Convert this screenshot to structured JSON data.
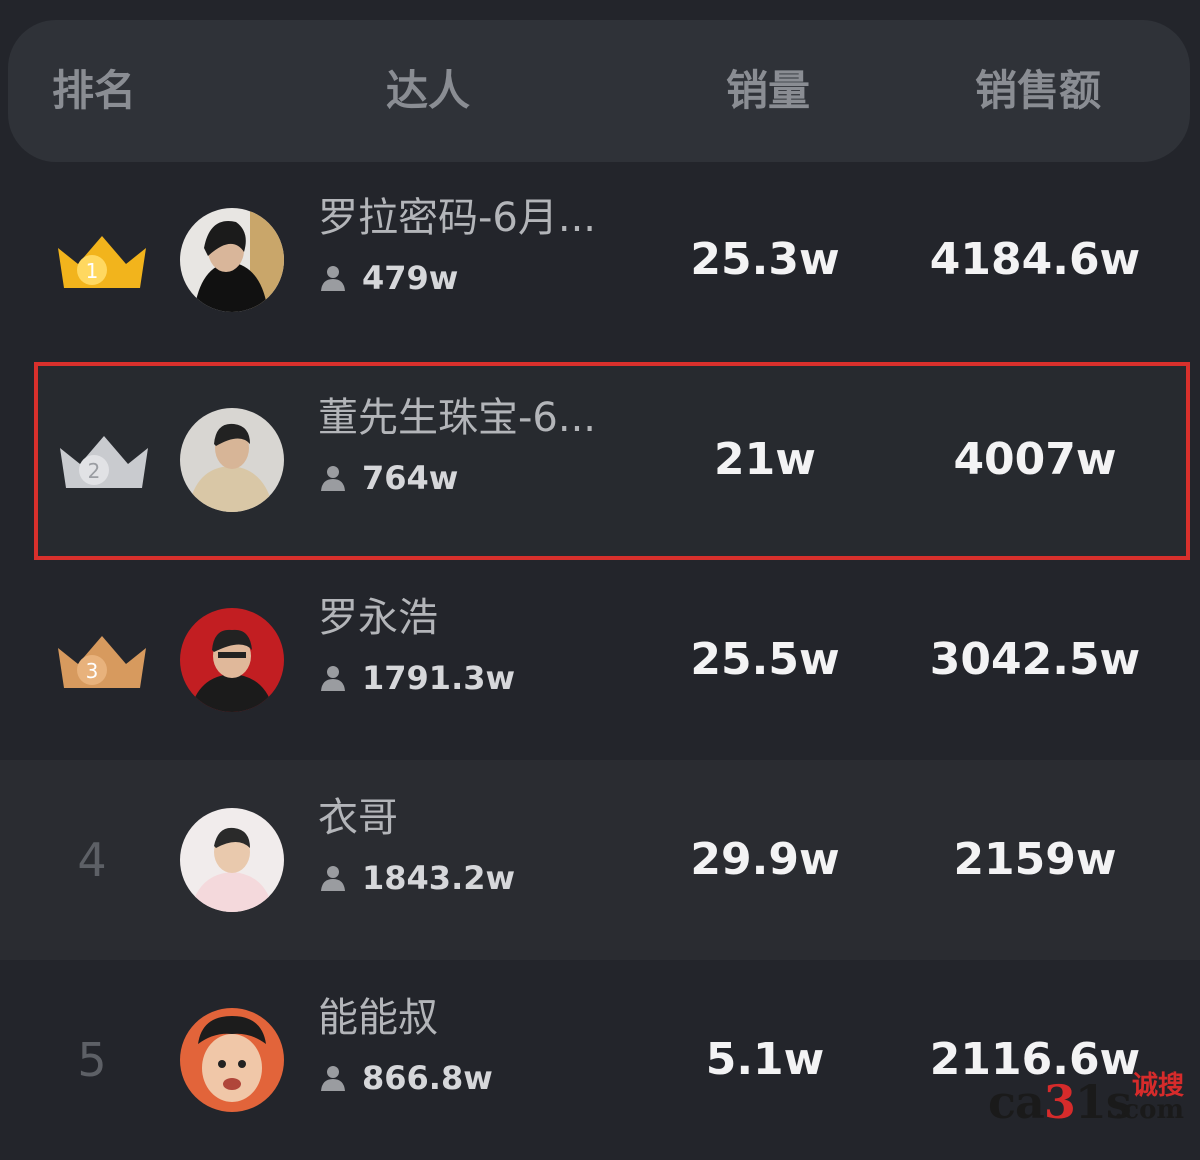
{
  "header": {
    "rank": "排名",
    "influencer": "达人",
    "sales_volume": "销量",
    "sales_amount": "销售额"
  },
  "rows": [
    {
      "rank": "1",
      "crown": "gold",
      "name": "罗拉密码-6月...",
      "fans": "479w",
      "sales": "25.3w",
      "amount": "4184.6w"
    },
    {
      "rank": "2",
      "crown": "silver",
      "name": "董先生珠宝-6...",
      "fans": "764w",
      "sales": "21w",
      "amount": "4007w",
      "highlighted": true
    },
    {
      "rank": "3",
      "crown": "bronze",
      "name": "罗永浩",
      "fans": "1791.3w",
      "sales": "25.5w",
      "amount": "3042.5w"
    },
    {
      "rank": "4",
      "name": "衣哥",
      "fans": "1843.2w",
      "sales": "29.9w",
      "amount": "2159w"
    },
    {
      "rank": "5",
      "name": "能能叔",
      "fans": "866.8w",
      "sales": "5.1w",
      "amount": "2116.6w"
    }
  ],
  "watermark": {
    "latin_a": "ca",
    "latin_b": "3",
    "latin_c": "1s",
    "cn": "诚搜",
    "domain": ".com"
  },
  "colors": {
    "highlight_border": "#d9302c",
    "gold": "#f2b41c",
    "silver": "#c9cbcf",
    "bronze": "#d79a5e"
  }
}
